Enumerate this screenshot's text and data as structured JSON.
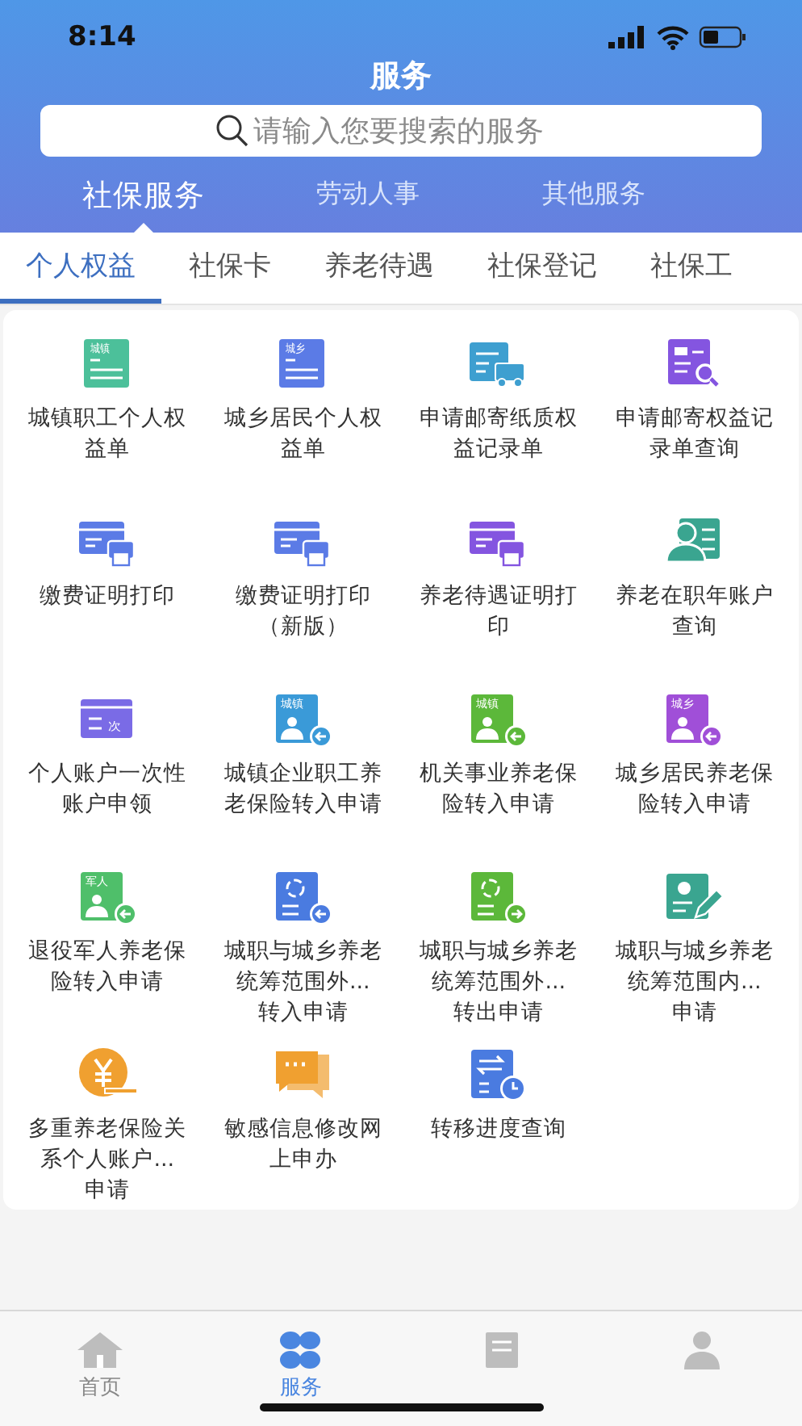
{
  "status_bar": {
    "time": "8:14"
  },
  "header": {
    "title": "服务",
    "search": {
      "placeholder": "请输入您要搜索的服务"
    }
  },
  "categories": [
    {
      "label": "社保服务",
      "selected": true
    },
    {
      "label": "劳动人事",
      "selected": false
    },
    {
      "label": "其他服务",
      "selected": false
    }
  ],
  "sub_tabs": [
    {
      "label": "个人权益",
      "selected": true
    },
    {
      "label": "社保卡",
      "selected": false
    },
    {
      "label": "养老待遇",
      "selected": false
    },
    {
      "label": "社保登记",
      "selected": false
    },
    {
      "label": "社保工",
      "selected": false
    }
  ],
  "services": [
    {
      "kind": "form",
      "color": "#4cc09a",
      "badge": "城镇",
      "label_lines": [
        "城镇职工个人权",
        "益单"
      ]
    },
    {
      "kind": "form",
      "color": "#5b7be6",
      "badge": "城乡",
      "label_lines": [
        "城乡居民个人权",
        "益单"
      ]
    },
    {
      "kind": "truck",
      "color": "#3e9fd0",
      "label_lines": [
        "申请邮寄纸质权",
        "益记录单"
      ]
    },
    {
      "kind": "doc-search",
      "color": "#8455e0",
      "label_lines": [
        "申请邮寄权益记",
        "录单查询"
      ]
    },
    {
      "kind": "card-print",
      "color": "#5b7be6",
      "label_lines": [
        "缴费证明打印"
      ]
    },
    {
      "kind": "card-print",
      "color": "#5b7be6",
      "label_lines": [
        "缴费证明打印",
        "（新版）"
      ]
    },
    {
      "kind": "card-print",
      "color": "#8455e0",
      "label_lines": [
        "养老待遇证明打",
        "印"
      ]
    },
    {
      "kind": "person-card",
      "color": "#3aa590",
      "label_lines": [
        "养老在职年账户",
        "查询"
      ]
    },
    {
      "kind": "once-card",
      "color": "#7a6be6",
      "badge": "次",
      "label_lines": [
        "个人账户一次性",
        "账户申领"
      ]
    },
    {
      "kind": "person-in",
      "color": "#3a9ad8",
      "badge": "城镇",
      "label_lines": [
        "城镇企业职工养",
        "老保险转入申请"
      ]
    },
    {
      "kind": "person-in",
      "color": "#5cb83a",
      "badge": "城镇",
      "label_lines": [
        "机关事业养老保",
        "险转入申请"
      ]
    },
    {
      "kind": "person-in",
      "color": "#a04fd8",
      "badge": "城乡",
      "label_lines": [
        "城乡居民养老保",
        "险转入申请"
      ]
    },
    {
      "kind": "person-in",
      "color": "#4fbf6a",
      "badge": "军人",
      "label_lines": [
        "退役军人养老保",
        "险转入申请"
      ]
    },
    {
      "kind": "cycle-in",
      "color": "#4a7be0",
      "label_lines": [
        "城职与城乡养老",
        "统筹范围外...",
        "转入申请"
      ]
    },
    {
      "kind": "cycle-out",
      "color": "#5cb83a",
      "label_lines": [
        "城职与城乡养老",
        "统筹范围外...",
        "转出申请"
      ]
    },
    {
      "kind": "edit",
      "color": "#3aa590",
      "label_lines": [
        "城职与城乡养老",
        "统筹范围内...",
        "申请"
      ]
    },
    {
      "kind": "yuan",
      "color": "#f0a030",
      "label_lines": [
        "多重养老保险关",
        "系个人账户...",
        "申请"
      ]
    },
    {
      "kind": "chat",
      "color": "#f0a030",
      "label_lines": [
        "敏感信息修改网",
        "上申办"
      ]
    },
    {
      "kind": "progress",
      "color": "#4a7be0",
      "label_lines": [
        "转移进度查询"
      ]
    }
  ],
  "bottom_nav": [
    {
      "kind": "home",
      "label": "首页",
      "selected": false
    },
    {
      "kind": "services",
      "label": "服务",
      "selected": true
    },
    {
      "kind": "document",
      "selected": false
    },
    {
      "kind": "person",
      "selected": false
    }
  ]
}
